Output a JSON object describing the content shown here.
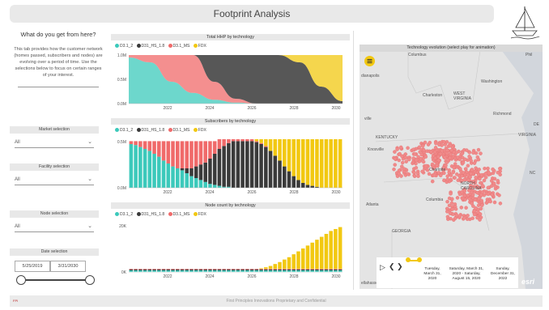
{
  "header": {
    "title": "Footprint Analysis"
  },
  "left_panel": {
    "heading": "What do you get from here?",
    "description": "This tab provides how the customer network (homes passed, subscribers and nodes) are evolving over a period of time. Use the selections below to focus on certain ranges of your interest.",
    "market": {
      "label": "Market selection",
      "value": "All"
    },
    "facility": {
      "label": "Facility selection",
      "value": "All"
    },
    "node": {
      "label": "Node selection",
      "value": "All"
    },
    "date": {
      "label": "Date selection",
      "start": "5/25/2019",
      "end": "3/31/2030"
    }
  },
  "legend": [
    {
      "name": "D3.1_2",
      "color": "#3cc9bb"
    },
    {
      "name": "D31_HS_1.8",
      "color": "#3a3a3a"
    },
    {
      "name": "D3.1_MS",
      "color": "#f06a6a"
    },
    {
      "name": "FDX",
      "color": "#f2c811"
    }
  ],
  "chart_data": [
    {
      "type": "area",
      "title": "Total HHP by technology",
      "x": [
        2020,
        2021,
        2022,
        2023,
        2024,
        2025,
        2026,
        2027,
        2028,
        2029,
        2030
      ],
      "x_ticks": [
        "2022",
        "2024",
        "2026",
        "2028",
        "2030"
      ],
      "y_ticks": [
        "1.0M",
        "0.5M",
        "0.0M"
      ],
      "ylim": [
        0,
        1.0
      ],
      "series": [
        {
          "name": "D3.1_2",
          "values": [
            0.95,
            0.85,
            0.45,
            0.22,
            0.08,
            0.02,
            0.0,
            0.0,
            0.0,
            0.0,
            0.0
          ]
        },
        {
          "name": "D31_HS_1.8",
          "values": [
            0.0,
            0.0,
            0.0,
            0.0,
            0.55,
            0.9,
            1.0,
            1.0,
            0.85,
            0.35,
            0.05
          ]
        },
        {
          "name": "D3.1_MS",
          "values": [
            0.05,
            0.15,
            0.55,
            0.78,
            0.37,
            0.08,
            0.0,
            0.0,
            0.0,
            0.0,
            0.0
          ]
        },
        {
          "name": "FDX",
          "values": [
            0.0,
            0.0,
            0.0,
            0.0,
            0.0,
            0.0,
            0.0,
            0.0,
            0.15,
            0.65,
            0.95
          ]
        }
      ]
    },
    {
      "type": "bar",
      "title": "Subscribers by technology",
      "x_ticks": [
        "2022",
        "2024",
        "2026",
        "2028",
        "2030"
      ],
      "y_ticks": [
        "0.5M",
        "0.0M"
      ],
      "ylim": [
        0,
        0.5
      ],
      "series": [
        {
          "name": "D3.1_2",
          "values": [
            0.45,
            0.44,
            0.42,
            0.4,
            0.38,
            0.35,
            0.32,
            0.28,
            0.25,
            0.22,
            0.2,
            0.18,
            0.15,
            0.12,
            0.1,
            0.08,
            0.06,
            0.04,
            0.03,
            0.02,
            0.01,
            0.01,
            0.0,
            0.0,
            0.0,
            0.0,
            0.0,
            0.0,
            0.0,
            0.0,
            0.0,
            0.0,
            0.0,
            0.0,
            0.0,
            0.0,
            0.0,
            0.0,
            0.0,
            0.0,
            0.0,
            0.0,
            0.0,
            0.0,
            0.0,
            0.0
          ]
        },
        {
          "name": "D31_HS_1.8",
          "values": [
            0.0,
            0.0,
            0.0,
            0.0,
            0.0,
            0.0,
            0.0,
            0.0,
            0.0,
            0.0,
            0.0,
            0.02,
            0.05,
            0.08,
            0.12,
            0.16,
            0.2,
            0.26,
            0.32,
            0.38,
            0.42,
            0.45,
            0.48,
            0.48,
            0.48,
            0.48,
            0.48,
            0.47,
            0.45,
            0.42,
            0.38,
            0.33,
            0.28,
            0.22,
            0.17,
            0.12,
            0.08,
            0.05,
            0.03,
            0.02,
            0.01,
            0.0,
            0.0,
            0.0,
            0.0,
            0.0
          ]
        },
        {
          "name": "D3.1_MS",
          "values": [
            0.03,
            0.04,
            0.06,
            0.08,
            0.1,
            0.13,
            0.16,
            0.2,
            0.23,
            0.26,
            0.28,
            0.28,
            0.28,
            0.28,
            0.26,
            0.24,
            0.22,
            0.18,
            0.13,
            0.1,
            0.07,
            0.04,
            0.02,
            0.02,
            0.02,
            0.02,
            0.02,
            0.01,
            0.01,
            0.01,
            0.0,
            0.0,
            0.0,
            0.0,
            0.0,
            0.0,
            0.0,
            0.0,
            0.0,
            0.0,
            0.0,
            0.0,
            0.0,
            0.0,
            0.0,
            0.0
          ]
        },
        {
          "name": "FDX",
          "values": [
            0.0,
            0.0,
            0.0,
            0.0,
            0.0,
            0.0,
            0.0,
            0.0,
            0.0,
            0.0,
            0.0,
            0.0,
            0.0,
            0.0,
            0.0,
            0.0,
            0.0,
            0.0,
            0.0,
            0.0,
            0.0,
            0.0,
            0.0,
            0.0,
            0.0,
            0.0,
            0.0,
            0.02,
            0.04,
            0.07,
            0.12,
            0.17,
            0.22,
            0.28,
            0.33,
            0.38,
            0.42,
            0.45,
            0.47,
            0.48,
            0.49,
            0.5,
            0.5,
            0.5,
            0.5,
            0.5
          ]
        }
      ]
    },
    {
      "type": "bar",
      "title": "Node count by technology",
      "x_ticks": [
        "2022",
        "2024",
        "2026",
        "2028",
        "2030"
      ],
      "y_ticks": [
        "20K",
        "0K"
      ],
      "ylim": [
        0,
        25
      ],
      "series": [
        {
          "name": "D3.1_2",
          "values": [
            0.8,
            0.8,
            0.8,
            0.8,
            0.8,
            0.8,
            0.8,
            0.8,
            0.8,
            0.8,
            0.8,
            0.8,
            0.8,
            0.8,
            0.8,
            0.8,
            0.8,
            0.8,
            0.8,
            0.8,
            0.8,
            0.8,
            0.8,
            0.8,
            0.8,
            0.8,
            0.8,
            0.8,
            0.8,
            0.8,
            0.8,
            0.8,
            0.8,
            0.8,
            0.8,
            0.8,
            0.8,
            0.8,
            0.8,
            0.8,
            0.8,
            0.8,
            0.8,
            0.8,
            0.8,
            0.8
          ]
        },
        {
          "name": "D31_HS_1.8",
          "values": [
            0.5,
            0.5,
            0.5,
            0.5,
            0.5,
            0.5,
            0.5,
            0.5,
            0.5,
            0.5,
            0.5,
            0.5,
            0.5,
            0.5,
            0.5,
            0.5,
            0.5,
            0.5,
            0.5,
            0.5,
            0.5,
            0.5,
            0.5,
            0.5,
            0.5,
            0.5,
            0.5,
            0.5,
            0.5,
            0.5,
            0.5,
            0.5,
            0.5,
            0.5,
            0.5,
            0.5,
            0.5,
            0.5,
            0.5,
            0.5,
            0.5,
            0.5,
            0.5,
            0.5,
            0.5,
            0.5
          ]
        },
        {
          "name": "D3.1_MS",
          "values": [
            0.3,
            0.3,
            0.3,
            0.3,
            0.3,
            0.3,
            0.3,
            0.3,
            0.3,
            0.3,
            0.3,
            0.3,
            0.3,
            0.3,
            0.3,
            0.3,
            0.3,
            0.3,
            0.3,
            0.3,
            0.3,
            0.3,
            0.3,
            0.3,
            0.3,
            0.3,
            0.3,
            0.3,
            0.3,
            0.3,
            0.3,
            0.3,
            0.3,
            0.3,
            0.3,
            0.3,
            0.3,
            0.3,
            0.3,
            0.3,
            0.3,
            0.3,
            0.3,
            0.3,
            0.3,
            0.3
          ]
        },
        {
          "name": "FDX",
          "values": [
            0,
            0,
            0,
            0,
            0,
            0,
            0,
            0,
            0,
            0,
            0,
            0,
            0,
            0,
            0,
            0,
            0,
            0,
            0,
            0,
            0,
            0,
            0,
            0,
            0,
            0,
            0,
            0,
            0.3,
            0.8,
            1.5,
            2.5,
            3.5,
            4.8,
            6,
            7.5,
            9,
            10.5,
            12,
            13.5,
            15,
            16.5,
            18,
            19.5,
            20.5,
            21.5
          ]
        }
      ]
    }
  ],
  "map": {
    "title": "Technology evolution (select play for animation)",
    "labels": [
      {
        "text": "Columbus"
      },
      {
        "text": "Washington"
      },
      {
        "text": "Charleston"
      },
      {
        "text": "WEST"
      },
      {
        "text": "VIRGINIA"
      },
      {
        "text": "Richmond"
      },
      {
        "text": "VIRGINIA"
      },
      {
        "text": "KENTUCKY"
      },
      {
        "text": "Knoxville"
      },
      {
        "text": "Charlotte"
      },
      {
        "text": "NORTH"
      },
      {
        "text": "CAROLINA"
      },
      {
        "text": "Columbia"
      },
      {
        "text": "Atlanta"
      },
      {
        "text": "GEORGIA"
      },
      {
        "text": "dianapolis"
      },
      {
        "text": "ville"
      },
      {
        "text": "ellahassee"
      },
      {
        "text": "Phil"
      },
      {
        "text": "DE"
      },
      {
        "text": "NC"
      }
    ],
    "timeline": [
      "Tuesday, March 31, 2020",
      "Saturday, March 31, 2020 - Saturday, August 15, 2020",
      "Sunday, December 31, 2022"
    ],
    "esri": "esri"
  },
  "footer": {
    "text": "First Principles Innovations Proprietary and Confidential",
    "logo": "FPI"
  }
}
